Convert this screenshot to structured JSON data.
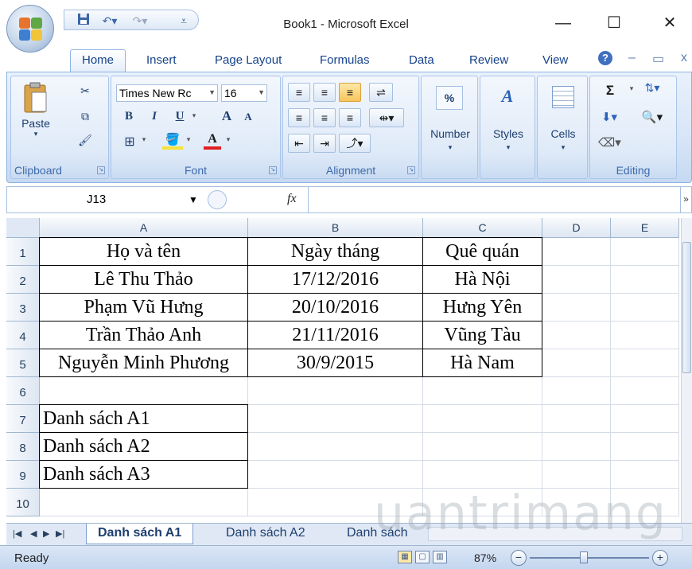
{
  "app": {
    "window_title": "Book1 - Microsoft Excel",
    "qat": {
      "save_icon": "save-icon",
      "undo_icon": "undo-icon",
      "redo_icon": "redo-icon",
      "customize_icon": "qat-dropdown-icon"
    },
    "window_controls": {
      "minimize": "—",
      "maximize": "☐",
      "close": "✕"
    }
  },
  "ribbon": {
    "tabs": [
      "Home",
      "Insert",
      "Page Layout",
      "Formulas",
      "Data",
      "Review",
      "View"
    ],
    "active_tab": "Home",
    "help_glyph": "?",
    "inner_controls": {
      "minimize": "–",
      "restore": "▭",
      "close": "x"
    },
    "clipboard": {
      "label": "Clipboard",
      "paste": "Paste"
    },
    "font": {
      "label": "Font",
      "name": "Times New Rc",
      "size": "16",
      "bold": "B",
      "italic": "I",
      "underline": "U",
      "grow": "A",
      "shrink": "A",
      "font_color": "A"
    },
    "alignment": {
      "label": "Alignment"
    },
    "number": {
      "label": "Number",
      "symbol": "%"
    },
    "styles": {
      "label": "Styles",
      "symbol": "A"
    },
    "cells": {
      "label": "Cells"
    },
    "editing": {
      "label": "Editing",
      "sigma": "Σ"
    }
  },
  "formula_bar": {
    "name_box": "J13",
    "fx": "fx",
    "content": ""
  },
  "sheet": {
    "columns": [
      "A",
      "B",
      "C",
      "D",
      "E"
    ],
    "rows": [
      "1",
      "2",
      "3",
      "4",
      "5",
      "6",
      "7",
      "8",
      "9",
      "10"
    ],
    "cells": {
      "A1": "Họ và tên",
      "B1": "Ngày tháng",
      "C1": "Quê quán",
      "A2": "Lê Thu Thảo",
      "B2": "17/12/2016",
      "C2": "Hà Nội",
      "A3": "Phạm Vũ Hưng",
      "B3": "20/10/2016",
      "C3": "Hưng Yên",
      "A4": "Trần Thảo Anh",
      "B4": "21/11/2016",
      "C4": "Vũng Tàu",
      "A5": "Nguyễn Minh Phương",
      "B5": "30/9/2015",
      "C5": "Hà Nam",
      "A7": "Danh sách A1",
      "A8": "Danh sách A2",
      "A9": "Danh sách A3"
    },
    "tabs": [
      "Danh sách A1",
      "Danh sách A2",
      "Danh sách"
    ],
    "active_tab": "Danh sách A1"
  },
  "status": {
    "ready": "Ready",
    "zoom": "87%",
    "zoom_out": "−",
    "zoom_in": "+"
  },
  "watermark": "uantrimang"
}
